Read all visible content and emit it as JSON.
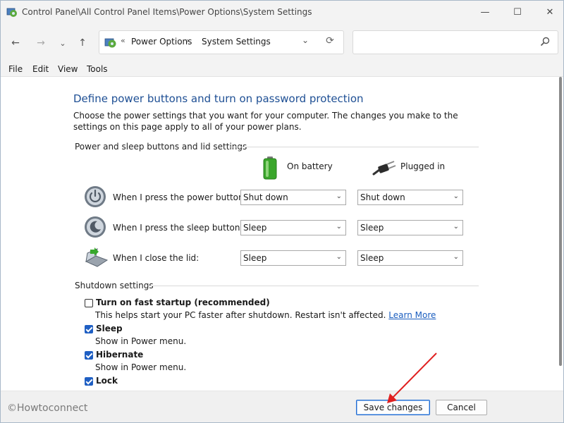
{
  "window": {
    "title": "Control Panel\\All Control Panel Items\\Power Options\\System Settings",
    "controls": {
      "minimize": "—",
      "maximize": "☐",
      "close": "✕"
    }
  },
  "nav": {
    "back": "←",
    "forward": "→",
    "recent": "⌄",
    "up": "↑",
    "breadcrumb_sep": "«",
    "breadcrumb": [
      "Power Options",
      "System Settings"
    ],
    "crumb_sep": "›",
    "dropdown": "⌄",
    "refresh": "⟳"
  },
  "search": {
    "placeholder": "",
    "value": ""
  },
  "menu": [
    "File",
    "Edit",
    "View",
    "Tools"
  ],
  "page": {
    "heading": "Define power buttons and turn on password protection",
    "description": "Choose the power settings that you want for your computer. The changes you make to the settings on this page apply to all of your power plans."
  },
  "power_section": {
    "title": "Power and sleep buttons and lid settings",
    "columns": [
      "On battery",
      "Plugged in"
    ],
    "rows": [
      {
        "label": "When I press the power button:",
        "battery": "Shut down",
        "plugged": "Shut down"
      },
      {
        "label": "When I press the sleep button:",
        "battery": "Sleep",
        "plugged": "Sleep"
      },
      {
        "label": "When I close the lid:",
        "battery": "Sleep",
        "plugged": "Sleep"
      }
    ]
  },
  "shutdown_section": {
    "title": "Shutdown settings",
    "options": [
      {
        "label": "Turn on fast startup (recommended)",
        "checked": false,
        "desc": "This helps start your PC faster after shutdown. Restart isn't affected.",
        "link": "Learn More"
      },
      {
        "label": "Sleep",
        "checked": true,
        "desc": "Show in Power menu."
      },
      {
        "label": "Hibernate",
        "checked": true,
        "desc": "Show in Power menu."
      },
      {
        "label": "Lock",
        "checked": true
      }
    ]
  },
  "footer": {
    "watermark": "©Howtoconnect",
    "save": "Save changes",
    "cancel": "Cancel"
  },
  "colors": {
    "heading": "#1e4f94",
    "link": "#1a5dbf",
    "checkbox": "#1f5fc3",
    "annotation_arrow": "#e02020"
  }
}
